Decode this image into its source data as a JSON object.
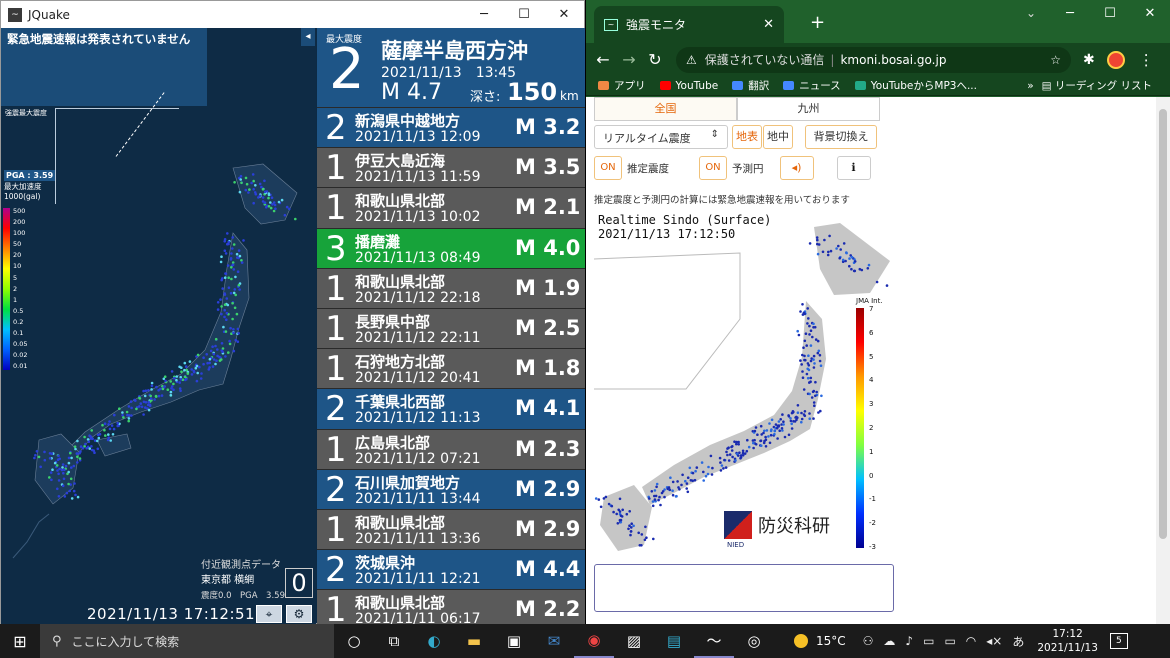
{
  "jquake": {
    "title": "JQuake",
    "warning": "緊急地震速報は発表されていません",
    "inset_label": "強震最大震度",
    "pga_label": "PGA : 3.59",
    "max_accel_label": "最大加速度",
    "accel_unit": "1000(gal)",
    "scale_ticks": [
      "500",
      "200",
      "100",
      "50",
      "20",
      "10",
      "5",
      "2",
      "1",
      "0.5",
      "0.2",
      "0.1",
      "0.05",
      "0.02",
      "0.01"
    ],
    "nearby_label": "付近観測点データ",
    "nearby_location": "東京都 横網",
    "nearby_intensity": "0",
    "nearby_values": "震度0.0　PGA　3.59",
    "clock": "2021/11/13 17:12:51",
    "latest": {
      "max_int_label": "最大震度",
      "intensity": "2",
      "place": "薩摩半島西方沖",
      "time": "2021/11/13　13:45",
      "magnitude": "M 4.7",
      "depth_label": "深さ:",
      "depth_value": "150",
      "depth_unit": "km"
    },
    "quakes": [
      {
        "intensity": "2",
        "place": "新潟県中越地方",
        "time": "2021/11/13 12:09",
        "magnitude": "M 3.2",
        "color": "#1e5587"
      },
      {
        "intensity": "1",
        "place": "伊豆大島近海",
        "time": "2021/11/13 11:59",
        "magnitude": "M 3.5",
        "color": "#5a5a5a"
      },
      {
        "intensity": "1",
        "place": "和歌山県北部",
        "time": "2021/11/13 10:02",
        "magnitude": "M 2.1",
        "color": "#5a5a5a"
      },
      {
        "intensity": "3",
        "place": "播磨灘",
        "time": "2021/11/13 08:49",
        "magnitude": "M 4.0",
        "color": "#17a33a"
      },
      {
        "intensity": "1",
        "place": "和歌山県北部",
        "time": "2021/11/12 22:18",
        "magnitude": "M 1.9",
        "color": "#5a5a5a"
      },
      {
        "intensity": "1",
        "place": "長野県中部",
        "time": "2021/11/12 22:11",
        "magnitude": "M 2.5",
        "color": "#5a5a5a"
      },
      {
        "intensity": "1",
        "place": "石狩地方北部",
        "time": "2021/11/12 20:41",
        "magnitude": "M 1.8",
        "color": "#5a5a5a"
      },
      {
        "intensity": "2",
        "place": "千葉県北西部",
        "time": "2021/11/12 11:13",
        "magnitude": "M 4.1",
        "color": "#1e5587"
      },
      {
        "intensity": "1",
        "place": "広島県北部",
        "time": "2021/11/12 07:21",
        "magnitude": "M 2.3",
        "color": "#5a5a5a"
      },
      {
        "intensity": "2",
        "place": "石川県加賀地方",
        "time": "2021/11/11 13:44",
        "magnitude": "M 2.9",
        "color": "#1e5587"
      },
      {
        "intensity": "1",
        "place": "和歌山県北部",
        "time": "2021/11/11 13:36",
        "magnitude": "M 2.9",
        "color": "#5a5a5a"
      },
      {
        "intensity": "2",
        "place": "茨城県沖",
        "time": "2021/11/11 12:21",
        "magnitude": "M 4.4",
        "color": "#1e5587"
      },
      {
        "intensity": "1",
        "place": "和歌山県北部",
        "time": "2021/11/11 06:17",
        "magnitude": "M 2.2",
        "color": "#5a5a5a"
      }
    ]
  },
  "chrome": {
    "tab_title": "強震モニタ",
    "url_warning": "保護されていない通信",
    "url": "kmoni.bosai.go.jp",
    "bookmarks": [
      {
        "label": "アプリ",
        "color": "#e84"
      },
      {
        "label": "YouTube",
        "color": "#f00"
      },
      {
        "label": "翻訳",
        "color": "#48f"
      },
      {
        "label": "ニュース",
        "color": "#48f"
      },
      {
        "label": "YouTubeからMP3へ...",
        "color": "#2a8"
      }
    ],
    "reading_list": "リーディング リスト",
    "page": {
      "region_tabs": [
        "全国",
        "九州"
      ],
      "mode_select": "リアルタイム震度",
      "surface_btn": "地表",
      "underground_btn": "地中",
      "bg_btn": "背景切換え",
      "toggle1_state": "ON",
      "toggle1_label": "推定震度",
      "toggle2_state": "ON",
      "toggle2_label": "予測円",
      "note": "推定震度と予測円の計算には緊急地震速報を用いております",
      "map_title": "Realtime Sindo (Surface)",
      "map_time": "2021/11/13  17:12:50",
      "legend_label": "JMA Int.",
      "legend_ticks": [
        "7",
        "6",
        "5",
        "4",
        "3",
        "2",
        "1",
        "0",
        "-1",
        "-2",
        "-3"
      ],
      "nied_text": "NIED",
      "nied_jp": "防災科研"
    }
  },
  "taskbar": {
    "search_placeholder": "ここに入力して検索",
    "temperature": "15°C",
    "ime": "あ",
    "time": "17:12",
    "date": "2021/11/13",
    "notifications": "5"
  }
}
